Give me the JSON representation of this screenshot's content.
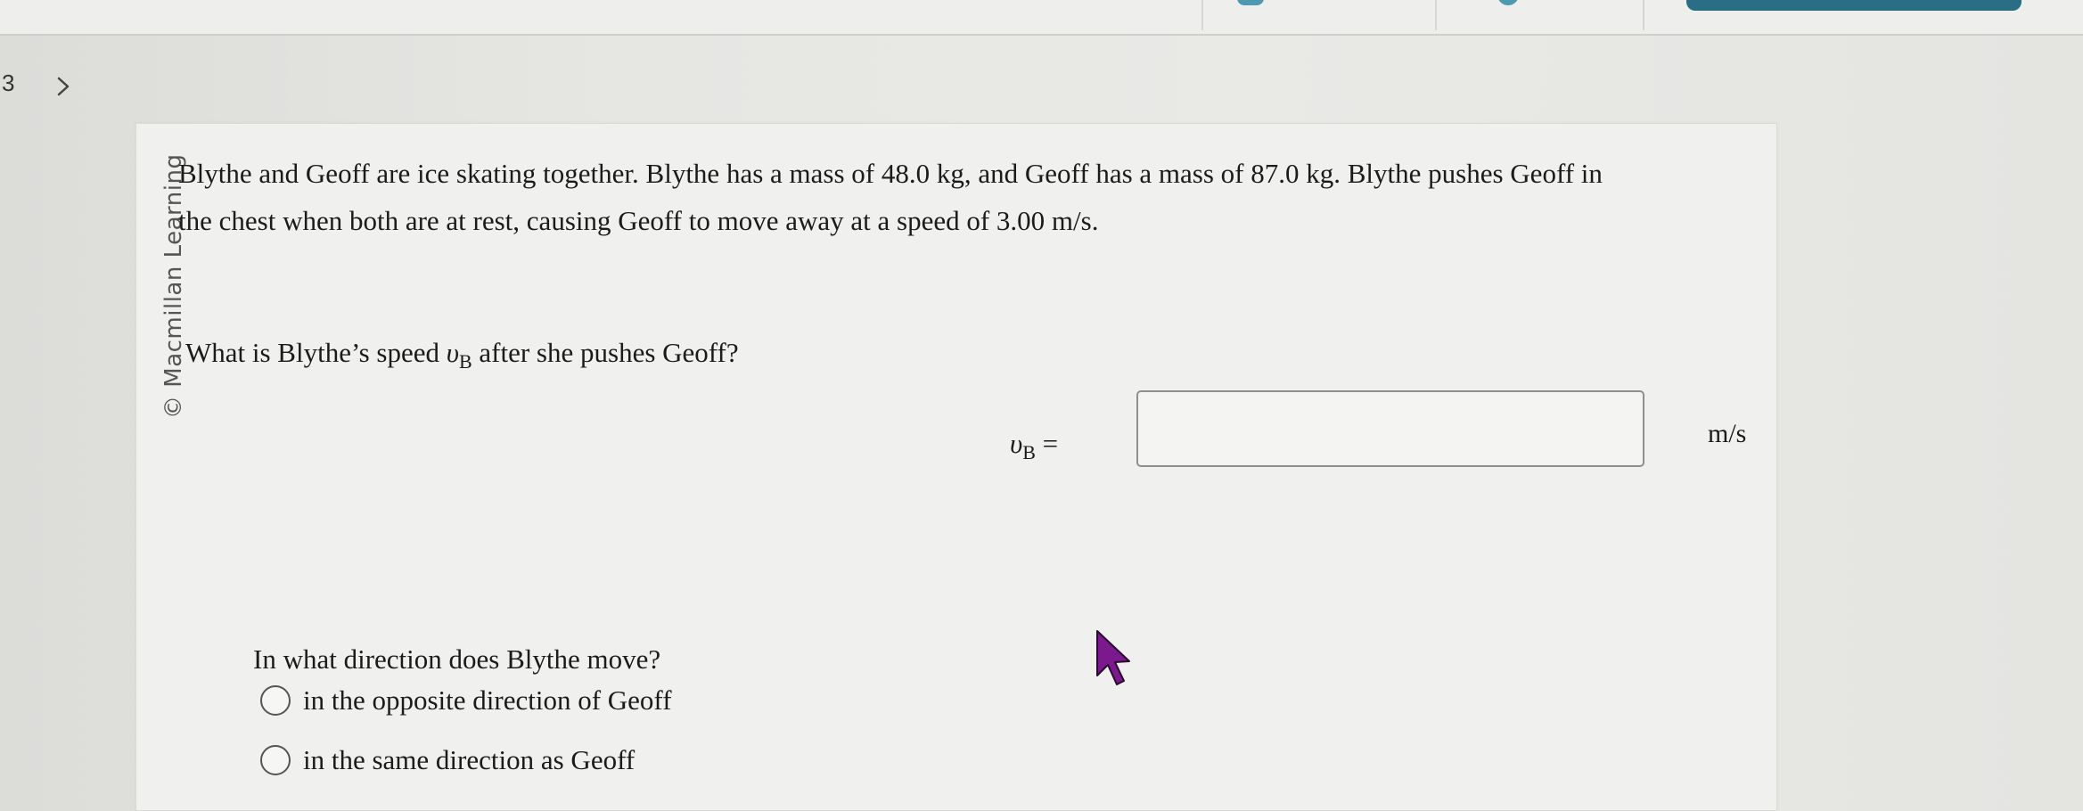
{
  "nav": {
    "question_number": "3",
    "next_icon": "chevron-right-icon"
  },
  "watermark": "© Macmillan Learning",
  "problem": {
    "line1": "Blythe and Geoff are ice skating together. Blythe has a mass of 48.0 kg, and Geoff has a mass of 87.0 kg. Blythe pushes Geoff in",
    "line2": "the chest when both are at rest, causing Geoff to move away at a speed of 3.00 m/s."
  },
  "question": {
    "prefix": "What is Blythe’s speed ",
    "var": "υ",
    "sub": "B",
    "suffix": " after she pushes Geoff?"
  },
  "answer": {
    "var": "υ",
    "sub": "B",
    "equals": " =",
    "value": "",
    "unit": "m/s"
  },
  "direction": {
    "question": "In what direction does Blythe move?",
    "options": [
      "in the opposite direction of Geoff",
      "in the same direction as Geoff"
    ]
  },
  "colors": {
    "accent": "#2a6e86",
    "cursor": "#7a1a8c"
  }
}
